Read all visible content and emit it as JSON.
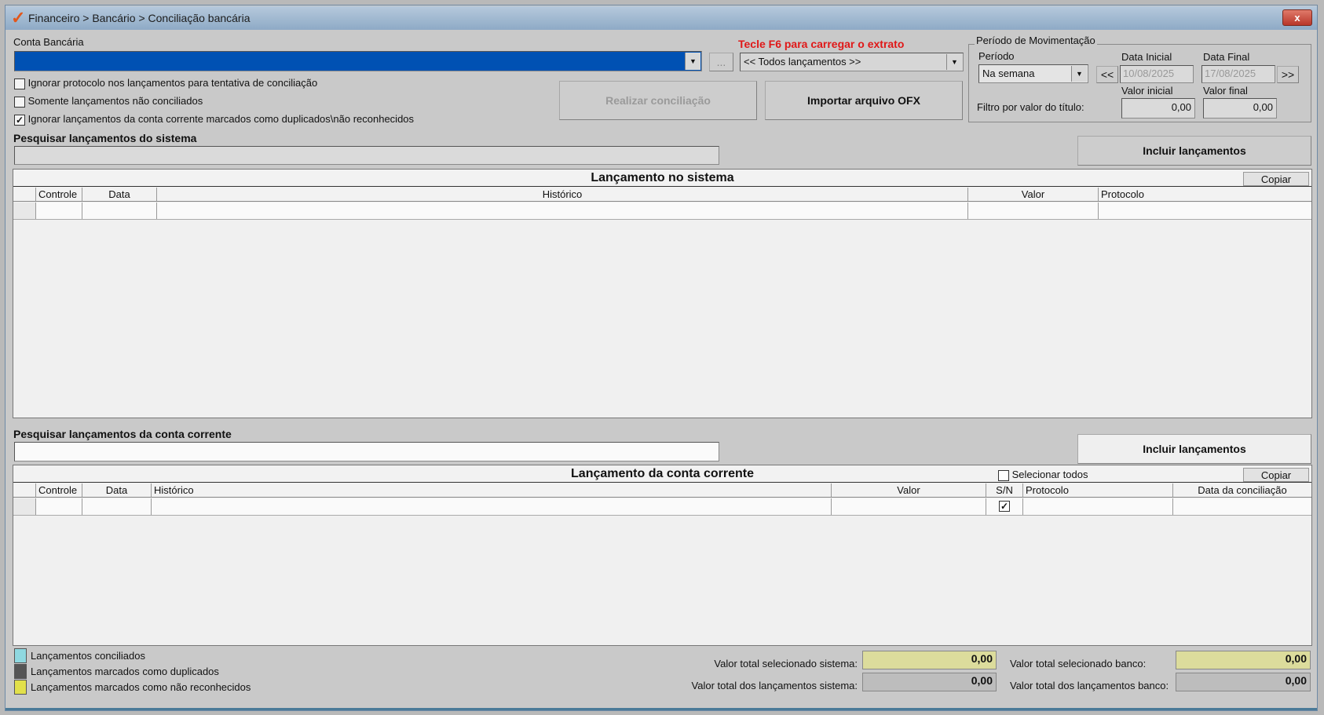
{
  "window": {
    "title": "Financeiro > Bancário > Conciliação bancária",
    "close_label": "x"
  },
  "account": {
    "label": "Conta Bancária",
    "value": "",
    "browse_label": "..."
  },
  "extract": {
    "hint": "Tecle F6 para carregar o extrato",
    "filter_value": "<< Todos lançamentos >>"
  },
  "options": [
    {
      "label": "Ignorar protocolo nos lançamentos para tentativa de conciliação",
      "checked": false
    },
    {
      "label": "Somente lançamentos não conciliados",
      "checked": false
    },
    {
      "label": "Ignorar lançamentos da conta corrente marcados como duplicados\\não reconhecidos",
      "checked": true
    }
  ],
  "buttons": {
    "reconcile": "Realizar conciliação",
    "import_ofx": "Importar arquivo OFX",
    "include_system": "Incluir lançamentos",
    "include_bank": "Incluir lançamentos",
    "copy_system": "Copiar",
    "copy_bank": "Copiar"
  },
  "period": {
    "group_label": "Período de Movimentação",
    "period_label": "Período",
    "period_value": "Na semana",
    "start_label": "Data Inicial",
    "start_value": "10/08/2025",
    "end_label": "Data Final",
    "end_value": "17/08/2025",
    "prev": "<<",
    "next": ">>",
    "min_label": "Valor inicial",
    "max_label": "Valor final",
    "filter_label": "Filtro por valor do título:",
    "min_value": "0,00",
    "max_value": "0,00"
  },
  "search_system": {
    "label": "Pesquisar lançamentos do sistema",
    "value": ""
  },
  "search_bank": {
    "label": "Pesquisar lançamentos da conta corrente",
    "value": ""
  },
  "system_grid": {
    "title": "Lançamento no sistema",
    "columns": [
      "",
      "Controle",
      "Data",
      "Histórico",
      "Valor",
      "Protocolo"
    ]
  },
  "bank_grid": {
    "title": "Lançamento da conta corrente",
    "select_all_label": "Selecionar todos",
    "columns": [
      "",
      "Controle",
      "Data",
      "Histórico",
      "Valor",
      "S/N",
      "Protocolo",
      "Data da conciliação"
    ],
    "row_checked": true
  },
  "legend": [
    {
      "label": "Lançamentos conciliados",
      "color": "#8fd8e0"
    },
    {
      "label": "Lançamentos marcados como duplicados",
      "color": "#555555"
    },
    {
      "label": "Lançamentos marcados como não reconhecidos",
      "color": "#e2e04a"
    }
  ],
  "totals": {
    "sel_system_label": "Valor total selecionado sistema:",
    "sel_system": "0,00",
    "all_system_label": "Valor total dos lançamentos sistema:",
    "all_system": "0,00",
    "sel_bank_label": "Valor total selecionado banco:",
    "sel_bank": "0,00",
    "all_bank_label": "Valor total dos lançamentos banco:",
    "all_bank": "0,00"
  }
}
